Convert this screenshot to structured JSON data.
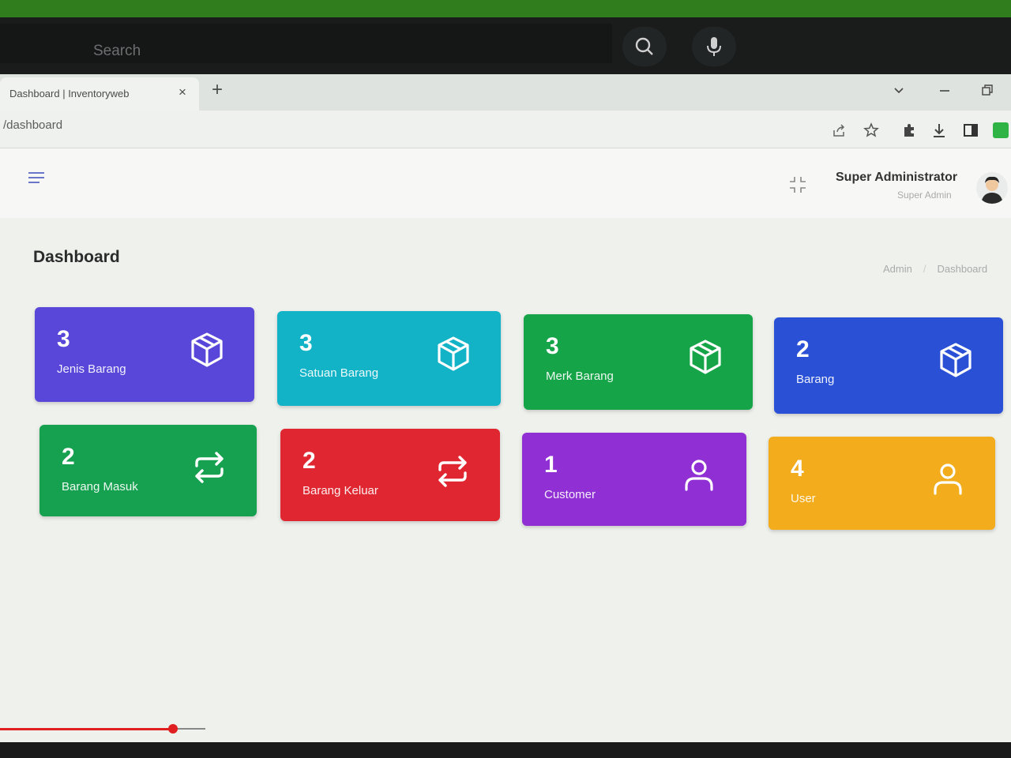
{
  "taskbar": {
    "search_placeholder": "Search",
    "search_icon": "search-icon",
    "mic_icon": "microphone-icon"
  },
  "browser": {
    "tab_title": "Dashboard | Inventoryweb",
    "tab_close": "×",
    "new_tab": "+",
    "url": "/dashboard",
    "window_controls": [
      "chevron-down-icon",
      "minimize-icon",
      "restore-icon"
    ],
    "extension_icons": [
      "share-icon",
      "star-icon",
      "puzzle-icon",
      "download-icon",
      "sidebar-icon",
      "profile-extension-icon"
    ]
  },
  "header": {
    "user_name": "Super Administrator",
    "user_role": "Super Admin"
  },
  "page": {
    "title": "Dashboard",
    "breadcrumb": [
      "Admin",
      "Dashboard"
    ]
  },
  "cards": [
    {
      "count": "3",
      "label": "Jenis Barang",
      "color": "#5847d8",
      "icon": "box-icon"
    },
    {
      "count": "3",
      "label": "Satuan Barang",
      "color": "#12b3c7",
      "icon": "box-icon"
    },
    {
      "count": "3",
      "label": "Merk Barang",
      "color": "#16a449",
      "icon": "box-icon"
    },
    {
      "count": "2",
      "label": "Barang",
      "color": "#2a50d6",
      "icon": "box-icon"
    },
    {
      "count": "2",
      "label": "Barang Masuk",
      "color": "#15a14f",
      "icon": "transfer-icon"
    },
    {
      "count": "2",
      "label": "Barang Keluar",
      "color": "#e02731",
      "icon": "transfer-icon"
    },
    {
      "count": "1",
      "label": "Customer",
      "color": "#8f2fd4",
      "icon": "user-icon"
    },
    {
      "count": "4",
      "label": "User",
      "color": "#f2ac1c",
      "icon": "user-icon"
    }
  ]
}
